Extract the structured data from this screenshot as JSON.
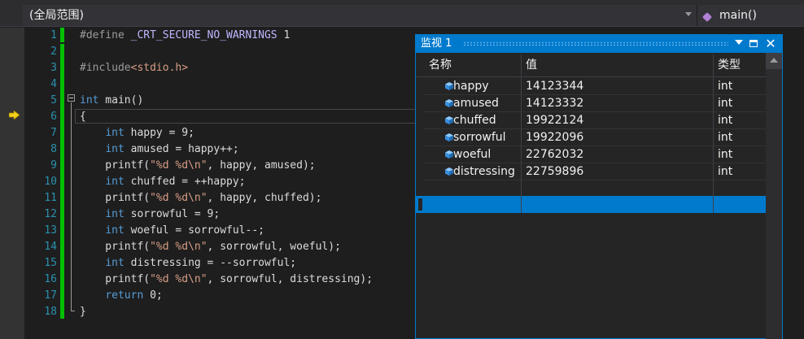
{
  "navbar": {
    "scope_label": "(全局范围)",
    "function_label": "main()"
  },
  "editor": {
    "line_numbers": [
      "1",
      "2",
      "3",
      "4",
      "5",
      "6",
      "7",
      "8",
      "9",
      "10",
      "11",
      "12",
      "13",
      "14",
      "15",
      "16",
      "17",
      "18"
    ],
    "lines": [
      "#define _CRT_SECURE_NO_WARNINGS 1",
      "",
      "#include<stdio.h>",
      "",
      "int main()",
      "{",
      "    int happy = 9;",
      "    int amused = happy++;",
      "    printf(\"%d %d\\n\", happy, amused);",
      "    int chuffed = ++happy;",
      "    printf(\"%d %d\\n\", happy, chuffed);",
      "    int sorrowful = 9;",
      "    int woeful = sorrowful--;",
      "    printf(\"%d %d\\n\", sorrowful, woeful);",
      "    int distressing = --sorrowful;",
      "    printf(\"%d %d\\n\", sorrowful, distressing);",
      "    return 0;",
      "}"
    ],
    "current_line": 6
  },
  "watch": {
    "title": "监视 1",
    "columns": {
      "name": "名称",
      "value": "值",
      "type": "类型"
    },
    "rows": [
      {
        "name": "happy",
        "value": "14123344",
        "type": "int"
      },
      {
        "name": "amused",
        "value": "14123332",
        "type": "int"
      },
      {
        "name": "chuffed",
        "value": "19922124",
        "type": "int"
      },
      {
        "name": "sorrowful",
        "value": "19922096",
        "type": "int"
      },
      {
        "name": "woeful",
        "value": "22762032",
        "type": "int"
      },
      {
        "name": "distressing",
        "value": "22759896",
        "type": "int"
      }
    ],
    "icons": {
      "variable": "variable-cube-icon",
      "dropdown": "chevron-down-icon",
      "maximize": "maximize-icon",
      "close": "close-icon"
    }
  },
  "colors": {
    "accent": "#007acc",
    "keyword": "#569cd6",
    "string": "#d69d85",
    "macro": "#beb7ff",
    "line_number": "#2b91af",
    "change_bar": "#00c000",
    "variable_icon": "#4aa3ff"
  }
}
